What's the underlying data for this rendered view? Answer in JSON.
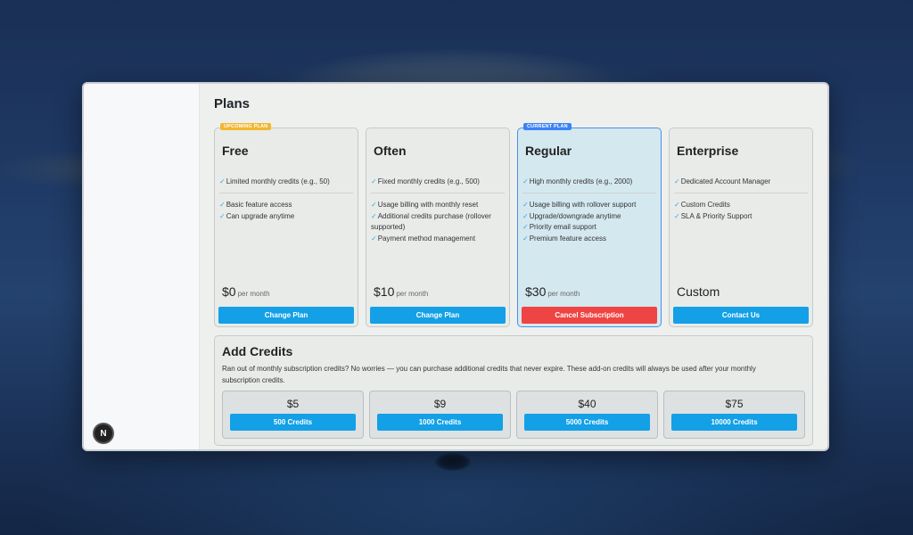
{
  "page": {
    "title": "Plans"
  },
  "plans": [
    {
      "badge": "UPCOMING PLAN",
      "name": "Free",
      "primary_feature": "Limited monthly credits (e.g., 50)",
      "features": [
        "Basic feature access",
        "Can upgrade anytime"
      ],
      "price": "$0",
      "per": "per month",
      "button": "Change Plan"
    },
    {
      "name": "Often",
      "primary_feature": "Fixed monthly credits (e.g., 500)",
      "features": [
        "Usage billing with monthly reset",
        "Additional credits purchase (rollover supported)",
        "Payment method management"
      ],
      "price": "$10",
      "per": "per month",
      "button": "Change Plan"
    },
    {
      "badge": "CURRENT PLAN",
      "name": "Regular",
      "primary_feature": "High monthly credits (e.g., 2000)",
      "features": [
        "Usage billing with rollover support",
        "Upgrade/downgrade anytime",
        "Priority email support",
        "Premium feature access"
      ],
      "price": "$30",
      "per": "per month",
      "button": "Cancel Subscription"
    },
    {
      "name": "Enterprise",
      "primary_feature": "Dedicated Account Manager",
      "features": [
        "Custom Credits",
        "SLA & Priority Support"
      ],
      "price": "Custom",
      "button": "Contact Us"
    }
  ],
  "credits": {
    "title": "Add Credits",
    "description": "Ran out of monthly subscription credits? No worries — you can purchase additional credits that never expire. These add-on credits will always be used after your monthly subscription credits.",
    "packs": [
      {
        "price": "$5",
        "button": "500 Credits"
      },
      {
        "price": "$9",
        "button": "1000 Credits"
      },
      {
        "price": "$40",
        "button": "5000 Credits"
      },
      {
        "price": "$75",
        "button": "10000 Credits"
      }
    ]
  },
  "sidebar": {
    "logo_letter": "N"
  },
  "colors": {
    "accent": "#13a0e6",
    "danger": "#ef4444",
    "current_plan_bg": "#d4e8ef",
    "current_badge": "#3b82f6",
    "upcoming_badge": "#f1b72f"
  },
  "icons": {
    "feature": "check-icon"
  }
}
